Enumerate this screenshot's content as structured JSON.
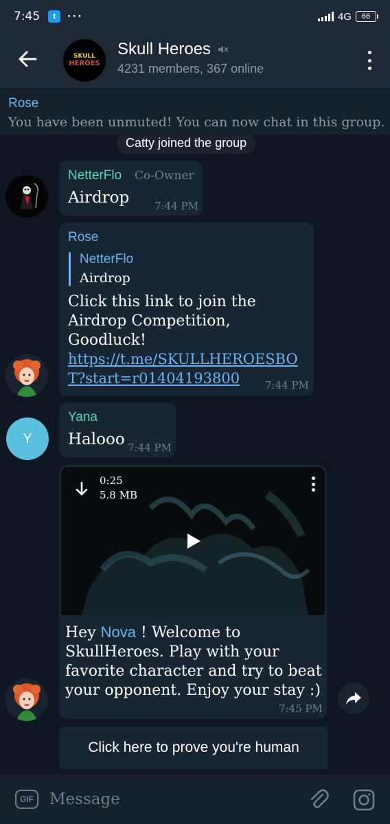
{
  "status_bar": {
    "time": "7:45",
    "notification_more": "···",
    "network": "4G",
    "battery": "66"
  },
  "header": {
    "title": "Skull Heroes",
    "subtitle": "4231 members, 367 online",
    "avatar_logo_top": "SKULL",
    "avatar_logo_bottom": "HEROES"
  },
  "pinned": {
    "sender": "Rose",
    "text": "You have been unmuted! You can now chat in this group."
  },
  "service_message": "Catty joined the group",
  "messages": [
    {
      "sender": "NetterFlo",
      "role": "Co-Owner",
      "text": "Airdrop",
      "time": "7:44 PM"
    },
    {
      "sender": "Rose",
      "reply_to": {
        "sender": "NetterFlo",
        "text": "Airdrop"
      },
      "text": "Click this link to join the Airdrop Competition, Goodluck!",
      "link": "https://t.me/SKULLHEROESBOT?start=r01404193800",
      "time": "7:44 PM"
    },
    {
      "sender": "Yana",
      "avatar_letter": "Y",
      "text": "Halooo",
      "time": "7:44 PM"
    },
    {
      "video": {
        "duration": "0:25",
        "size": "5.8 MB"
      },
      "text_before": "Hey ",
      "mention": "Nova",
      "text_after": " ! Welcome to SkullHeroes. Play with your favorite character and try to beat your opponent. Enjoy your stay :)",
      "time": "7:45 PM"
    }
  ],
  "inline_button": "Click here to prove you're human",
  "input": {
    "gif_label": "GIF",
    "placeholder": "Message"
  },
  "colors": {
    "background": "#0e1621",
    "header": "#1e2935",
    "bubble": "#182533",
    "link": "#6ab3f3",
    "name_teal": "#57d6c7"
  }
}
